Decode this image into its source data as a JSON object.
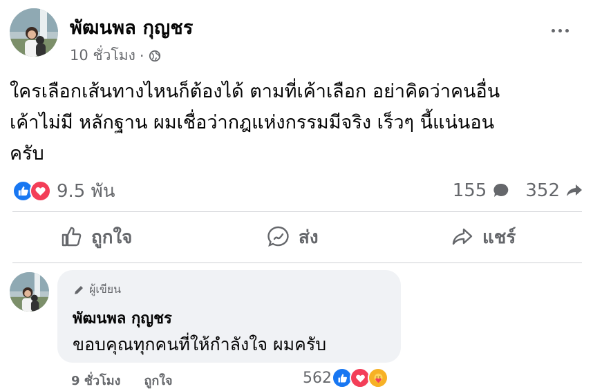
{
  "post": {
    "author": "พัฒนพล กุญชร",
    "time": "10 ชั่วโมง",
    "separator": "·",
    "text": "ใครเลือกเส้นทางไหนก็ต้องได้ ตามที่เค้าเลือก อย่าคิดว่าคนอื่น\nเค้าไม่มี หลักฐาน ผมเชื่อว่ากฎแห่งกรรมมีจริง เร็วๆ นี้แน่นอน\nครับ",
    "reaction_count": "9.5 พัน",
    "comment_count": "155",
    "share_count": "352"
  },
  "actions": {
    "like_label": "ถูกใจ",
    "send_label": "ส่ง",
    "share_label": "แชร์"
  },
  "comment": {
    "badge": "ผู้เขียน",
    "author": "พัฒนพล กุญชร",
    "text": "ขอบคุณทุกคนที่ให้กำลังใจ ผมครับ",
    "time": "9 ชั่วโมง",
    "like_label": "ถูกใจ",
    "reaction_count": "562"
  },
  "colors": {
    "like_blue": "#1877f2",
    "love_red": "#f33e58",
    "care_yellow": "#f7b125",
    "secondary_text": "#65676b"
  },
  "icons": [
    "globe-icon",
    "more-dots-icon",
    "like-reaction-icon",
    "love-reaction-icon",
    "comment-bubble-icon",
    "share-arrow-icon",
    "thumbs-up-icon",
    "messenger-icon",
    "share-icon",
    "pencil-icon",
    "care-reaction-icon"
  ]
}
